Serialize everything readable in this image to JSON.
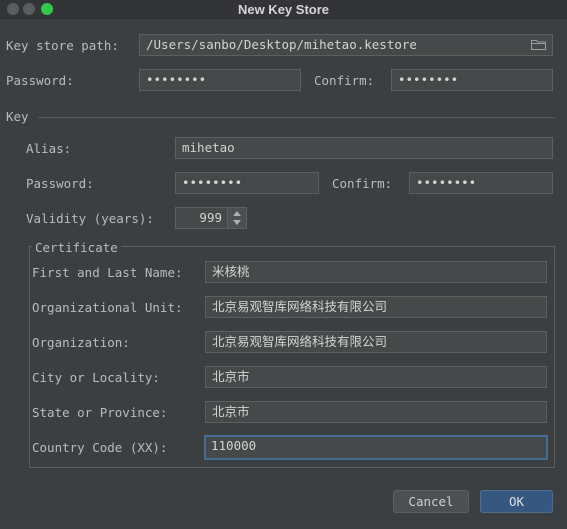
{
  "window": {
    "title": "New Key Store"
  },
  "keystore": {
    "path_label": "Key store path:",
    "path_value": "/Users/sanbo/Desktop/mihetao.kestore",
    "password_label": "Password:",
    "password_value": "••••••••",
    "confirm_label": "Confirm:",
    "confirm_value": "••••••••"
  },
  "key": {
    "section_label": "Key",
    "alias_label": "Alias:",
    "alias_value": "mihetao",
    "password_label": "Password:",
    "password_value": "••••••••",
    "confirm_label": "Confirm:",
    "confirm_value": "••••••••",
    "validity_label": "Validity (years):",
    "validity_value": "999"
  },
  "certificate": {
    "legend": "Certificate",
    "name_label": "First and Last Name:",
    "name_value": "米核桃",
    "unit_label": "Organizational Unit:",
    "unit_value": "北京易观智库网络科技有限公司",
    "org_label": "Organization:",
    "org_value": "北京易观智库网络科技有限公司",
    "city_label": "City or Locality:",
    "city_value": "北京市",
    "state_label": "State or Province:",
    "state_value": "北京市",
    "country_label": "Country Code (XX):",
    "country_value": "110000"
  },
  "buttons": {
    "cancel": "Cancel",
    "ok": "OK"
  }
}
